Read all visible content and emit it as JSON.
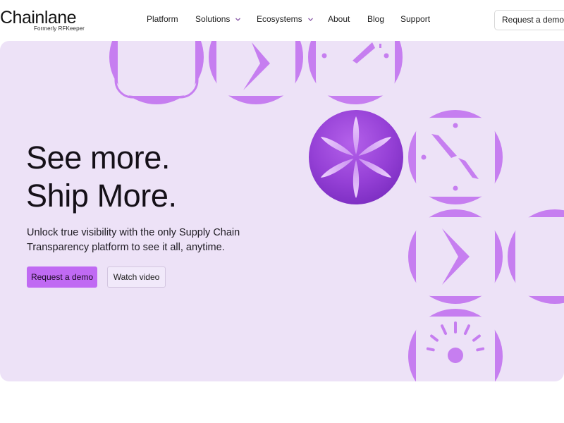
{
  "brand": {
    "name": "Chainlane",
    "tagline": "Formerly RFKeeper"
  },
  "nav": {
    "items": [
      {
        "label": "Platform",
        "has_dropdown": false
      },
      {
        "label": "Solutions",
        "has_dropdown": true
      },
      {
        "label": "Ecosystems",
        "has_dropdown": true
      },
      {
        "label": "About",
        "has_dropdown": false
      },
      {
        "label": "Blog",
        "has_dropdown": false
      },
      {
        "label": "Support",
        "has_dropdown": false
      }
    ],
    "cta_label": "Request a demo"
  },
  "hero": {
    "headline_line1": "See more.",
    "headline_line2": "Ship More.",
    "subtext": "Unlock true visibility with the only Supply Chain Transparency platform to see it all, anytime.",
    "primary_button": "Request a demo",
    "secondary_button": "Watch video"
  },
  "icons": [
    "rounded-square-tile-icon",
    "play-arrow-tile-icon",
    "clock-tile-icon",
    "asterisk-orb-icon",
    "sunrise-tile-icon"
  ],
  "colors": {
    "accent": "#c06af3",
    "tile_purple": "#c67ef0",
    "hero_background": "#ede2f7",
    "orb": "#9d45d8"
  }
}
